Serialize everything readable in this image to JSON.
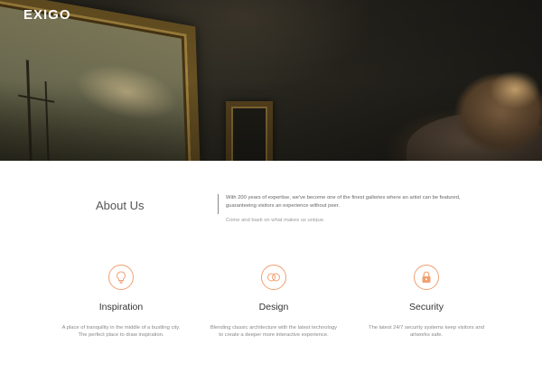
{
  "header": {
    "logo": "EXIGO"
  },
  "about": {
    "title": "About Us",
    "text": "With 200 years of expertise, we've become one of the finest galleries where an artist can be featured, guaranteeing visitors an experience without peer.",
    "sub": "Come and bask on what makes us unique."
  },
  "features": [
    {
      "icon": "lightbulb-icon",
      "title": "Inspiration",
      "desc": "A place of tranquility in the middle of a bustling city. The perfect place to draw inspiration."
    },
    {
      "icon": "rings-icon",
      "title": "Design",
      "desc": "Blending classic architecture with the latest technology to create a deeper more interactive experience."
    },
    {
      "icon": "lock-icon",
      "title": "Security",
      "desc": "The latest 24/7 security systems keep visitors and artworks safe."
    }
  ],
  "colors": {
    "accent": "#f2a070"
  }
}
